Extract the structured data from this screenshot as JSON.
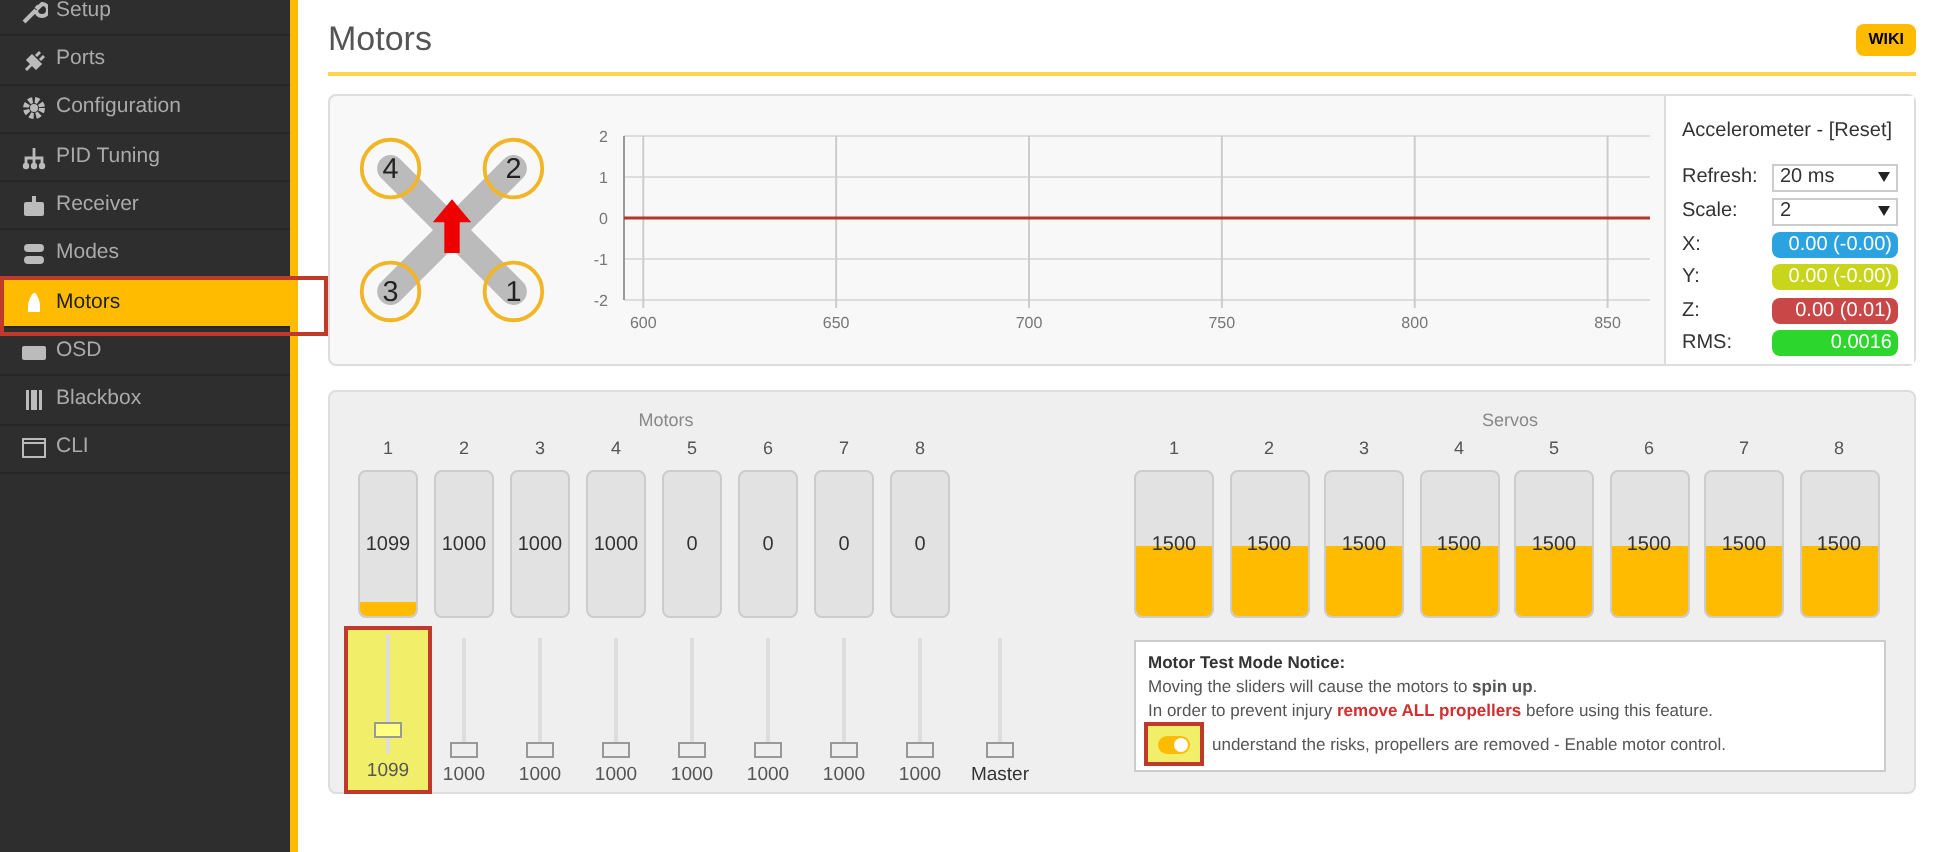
{
  "sidebar": {
    "items": [
      {
        "label": "Setup",
        "selected": false,
        "highlight": false
      },
      {
        "label": "Ports",
        "selected": false,
        "highlight": false
      },
      {
        "label": "Configuration",
        "selected": false,
        "highlight": false
      },
      {
        "label": "PID Tuning",
        "selected": false,
        "highlight": false
      },
      {
        "label": "Receiver",
        "selected": false,
        "highlight": false
      },
      {
        "label": "Modes",
        "selected": false,
        "highlight": false
      },
      {
        "label": "Motors",
        "selected": true,
        "highlight": true
      },
      {
        "label": "OSD",
        "selected": false,
        "highlight": false
      },
      {
        "label": "Blackbox",
        "selected": false,
        "highlight": false
      },
      {
        "label": "CLI",
        "selected": false,
        "highlight": false
      }
    ]
  },
  "page": {
    "title": "Motors",
    "wiki_button": "WIKI"
  },
  "quad": {
    "motors": [
      "4",
      "2",
      "3",
      "1"
    ]
  },
  "sensor_graph": {
    "chart_data": {
      "type": "line",
      "x": [
        595,
        861
      ],
      "series": [
        {
          "color": "#b5362b",
          "values": [
            0,
            0
          ]
        }
      ],
      "grid": true,
      "xlim": [
        595,
        861
      ],
      "ylim": [
        -2,
        2
      ],
      "xticks": [
        600,
        650,
        700,
        750,
        800,
        850
      ],
      "yticks": [
        2,
        1,
        0,
        -1,
        -2
      ]
    }
  },
  "accelerometer": {
    "title": "Accelerometer - [Reset]",
    "refresh": {
      "label": "Refresh:",
      "value": "20 ms"
    },
    "scale": {
      "label": "Scale:",
      "value": "2"
    },
    "readings": [
      {
        "label": "X:",
        "value": "0.00 (-0.00)",
        "color": "#2ba3e0"
      },
      {
        "label": "Y:",
        "value": "0.00 (-0.00)",
        "color": "#c9d51c"
      },
      {
        "label": "Z:",
        "value": "0.00 (0.01)",
        "color": "#c94747"
      },
      {
        "label": "RMS:",
        "value": "0.0016",
        "color": "#2dd62d"
      }
    ]
  },
  "motors": {
    "title": "Motors",
    "channels": [
      {
        "number": "1",
        "reading": "1099",
        "level": 0.1,
        "slider": {
          "value": "1099",
          "level": 0.15
        },
        "highlight": true
      },
      {
        "number": "2",
        "reading": "1000",
        "level": 0,
        "slider": {
          "value": "1000",
          "level": 0
        },
        "highlight": false
      },
      {
        "number": "3",
        "reading": "1000",
        "level": 0,
        "slider": {
          "value": "1000",
          "level": 0
        },
        "highlight": false
      },
      {
        "number": "4",
        "reading": "1000",
        "level": 0,
        "slider": {
          "value": "1000",
          "level": 0
        },
        "highlight": false
      },
      {
        "number": "5",
        "reading": "0",
        "level": 0,
        "slider": {
          "value": "1000",
          "level": 0
        },
        "highlight": false
      },
      {
        "number": "6",
        "reading": "0",
        "level": 0,
        "slider": {
          "value": "1000",
          "level": 0
        },
        "highlight": false
      },
      {
        "number": "7",
        "reading": "0",
        "level": 0,
        "slider": {
          "value": "1000",
          "level": 0
        },
        "highlight": false
      },
      {
        "number": "8",
        "reading": "0",
        "level": 0,
        "slider": {
          "value": "1000",
          "level": 0
        },
        "highlight": false
      }
    ],
    "master": {
      "label": "Master",
      "level": 0
    }
  },
  "servos": {
    "title": "Servos",
    "channels": [
      {
        "number": "1",
        "reading": "1500",
        "level": 0.49
      },
      {
        "number": "2",
        "reading": "1500",
        "level": 0.49
      },
      {
        "number": "3",
        "reading": "1500",
        "level": 0.49
      },
      {
        "number": "4",
        "reading": "1500",
        "level": 0.49
      },
      {
        "number": "5",
        "reading": "1500",
        "level": 0.49
      },
      {
        "number": "6",
        "reading": "1500",
        "level": 0.49
      },
      {
        "number": "7",
        "reading": "1500",
        "level": 0.49
      },
      {
        "number": "8",
        "reading": "1500",
        "level": 0.49
      }
    ]
  },
  "notice": {
    "title": "Motor Test Mode Notice:",
    "line_1": "Moving the sliders will cause the motors to **spin up**.",
    "line_2": "In order to prevent injury **remove ALL propellers** before using this feature.",
    "toggle": {
      "on": true,
      "highlight": true
    },
    "toggle_label": "understand the risks, propellers are removed - Enable motor control."
  }
}
